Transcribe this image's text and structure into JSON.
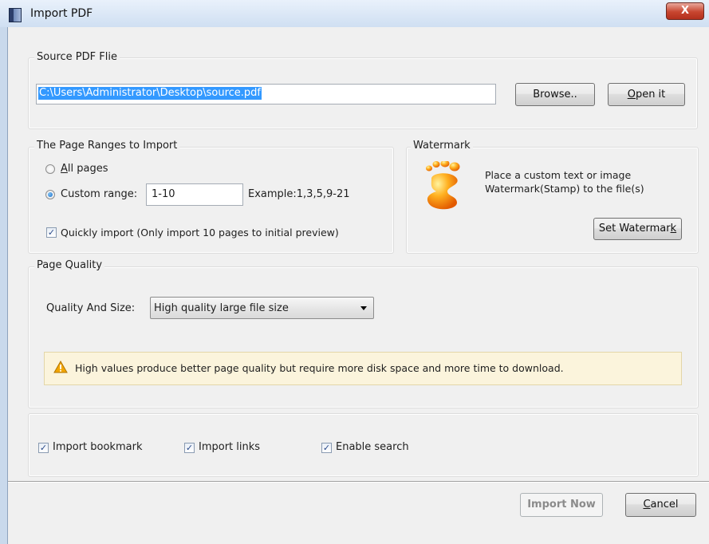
{
  "window": {
    "title": "Import PDF",
    "close_glyph": "X"
  },
  "source": {
    "legend": "Source PDF Flie",
    "path": "C:\\Users\\Administrator\\Desktop\\source.pdf",
    "browse_label": "Browse..",
    "open_label_hotkey": "O",
    "open_label_rest": "pen it"
  },
  "ranges": {
    "legend": "The Page Ranges to Import",
    "all_hotkey": "A",
    "all_rest": "ll pages",
    "custom_label": "Custom range:",
    "custom_value": "1-10",
    "example": "Example:1,3,5,9-21",
    "quick_label": "Quickly import (Only import 10 pages to  initial  preview)",
    "selected": "custom",
    "quick_checked": true
  },
  "watermark": {
    "legend": "Watermark",
    "desc_line1": "Place a custom text or image",
    "desc_line2": "Watermark(Stamp) to the file(s)",
    "button_main": "Set Watermar",
    "button_hotkey": "k"
  },
  "quality": {
    "legend": "Page Quality",
    "label": "Quality And Size:",
    "selected": "High quality large file size",
    "warning": "High values produce better page quality but require more disk space and more time to download."
  },
  "options": {
    "bookmark": "Import bookmark",
    "links": "Import links",
    "search": "Enable search",
    "bookmark_checked": true,
    "links_checked": true,
    "search_checked": true
  },
  "footer": {
    "import_label": "Import Now",
    "cancel_hotkey": "C",
    "cancel_rest": "ancel"
  },
  "colors": {
    "selection": "#3399ff",
    "warning_bg": "#fbf4dc",
    "title_gradient_top": "#e9f1fb"
  }
}
